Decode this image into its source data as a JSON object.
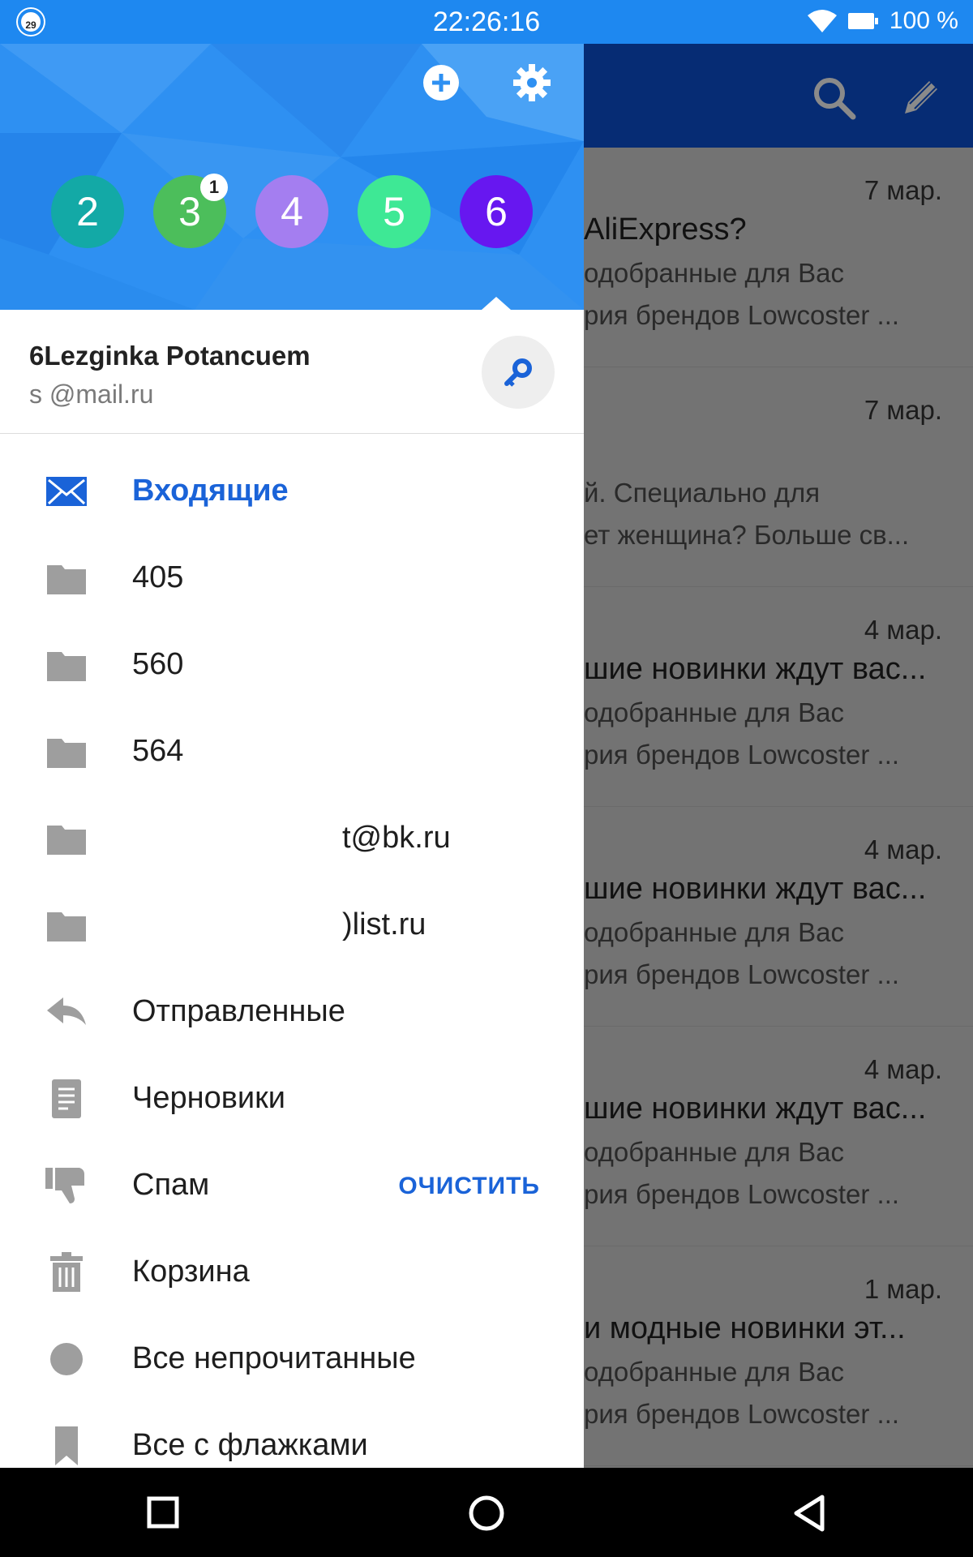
{
  "status_bar": {
    "notification_count": "29",
    "time": "22:26:16",
    "battery": "100 %"
  },
  "background_list": [
    {
      "date": "7 мар.",
      "subject": "AliExpress?",
      "preview1": "одобранные для Вас",
      "preview2": "рия брендов Lowcoster ..."
    },
    {
      "date": "7 мар.",
      "subject": "",
      "preview1": "й. Специально для",
      "preview2": "ет женщина? Больше св..."
    },
    {
      "date": "4 мар.",
      "subject": "шие новинки ждут вас...",
      "preview1": "одобранные для Вас",
      "preview2": "рия брендов Lowcoster ..."
    },
    {
      "date": "4 мар.",
      "subject": "шие новинки ждут вас...",
      "preview1": "одобранные для Вас",
      "preview2": "рия брендов Lowcoster ..."
    },
    {
      "date": "4 мар.",
      "subject": "шие новинки ждут вас...",
      "preview1": "одобранные для Вас",
      "preview2": "рия брендов Lowcoster ..."
    },
    {
      "date": "1 мар.",
      "subject": "и модные новинки эт...",
      "preview1": "одобранные для Вас",
      "preview2": "рия брендов Lowcoster ..."
    }
  ],
  "drawer": {
    "accounts": [
      {
        "label": "2",
        "color": "#13a9a6",
        "badge": ""
      },
      {
        "label": "3",
        "color": "#4cbe5b",
        "badge": "1"
      },
      {
        "label": "4",
        "color": "#a47ef0",
        "badge": ""
      },
      {
        "label": "5",
        "color": "#3ee895",
        "badge": ""
      },
      {
        "label": "6",
        "color": "#6717f0",
        "badge": ""
      }
    ],
    "account_name": "6Lezginka Potancuem",
    "account_email": "s            @mail.ru",
    "menu": [
      {
        "label": "Входящие",
        "icon": "envelope-icon",
        "active": true
      },
      {
        "label": "405",
        "icon": "folder-icon"
      },
      {
        "label": "560",
        "icon": "folder-icon"
      },
      {
        "label": "564",
        "icon": "folder-icon"
      },
      {
        "label": "t@bk.ru",
        "icon": "folder-icon"
      },
      {
        "label": ")list.ru",
        "icon": "folder-icon"
      },
      {
        "label": "Отправленные",
        "icon": "reply-icon"
      },
      {
        "label": "Черновики",
        "icon": "document-icon"
      },
      {
        "label": "Спам",
        "icon": "thumbs-down-icon",
        "action": "ОЧИСТИТЬ"
      },
      {
        "label": "Корзина",
        "icon": "trash-icon"
      },
      {
        "label": "Все непрочитанные",
        "icon": "unread-circle-icon"
      },
      {
        "label": "Все с флажками",
        "icon": "bookmark-icon"
      }
    ]
  },
  "colors": {
    "status_bar": "#1e88f0",
    "toolbar": "#062c74",
    "accent": "#1a63d8",
    "scrim_list": "#737373"
  }
}
